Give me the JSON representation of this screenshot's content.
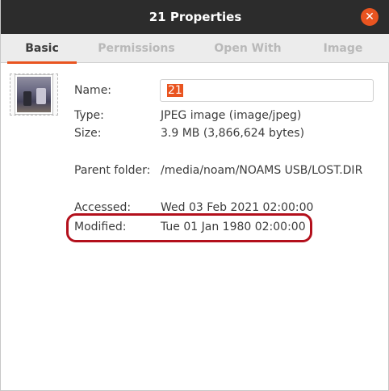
{
  "window": {
    "title": "21 Properties"
  },
  "tabs": [
    {
      "label": "Basic"
    },
    {
      "label": "Permissions"
    },
    {
      "label": "Open With"
    },
    {
      "label": "Image"
    }
  ],
  "colors": {
    "accent": "#e95420",
    "highlight": "#b3101c",
    "titlebar": "#2c2c2c"
  },
  "fields": {
    "name": {
      "label": "Name:",
      "value": "21"
    },
    "type": {
      "label": "Type:",
      "value": "JPEG image (image/jpeg)"
    },
    "size": {
      "label": "Size:",
      "value": "3.9 MB (3,866,624 bytes)"
    },
    "parent_folder": {
      "label": "Parent folder:",
      "value": "/media/noam/NOAMS USB/LOST.DIR"
    },
    "accessed": {
      "label": "Accessed:",
      "value": "Wed 03 Feb 2021 02:00:00"
    },
    "modified": {
      "label": "Modified:",
      "value": "Tue 01 Jan 1980 02:00:00"
    }
  },
  "icons": {
    "close": "close-icon",
    "thumbnail": "image-thumbnail"
  }
}
